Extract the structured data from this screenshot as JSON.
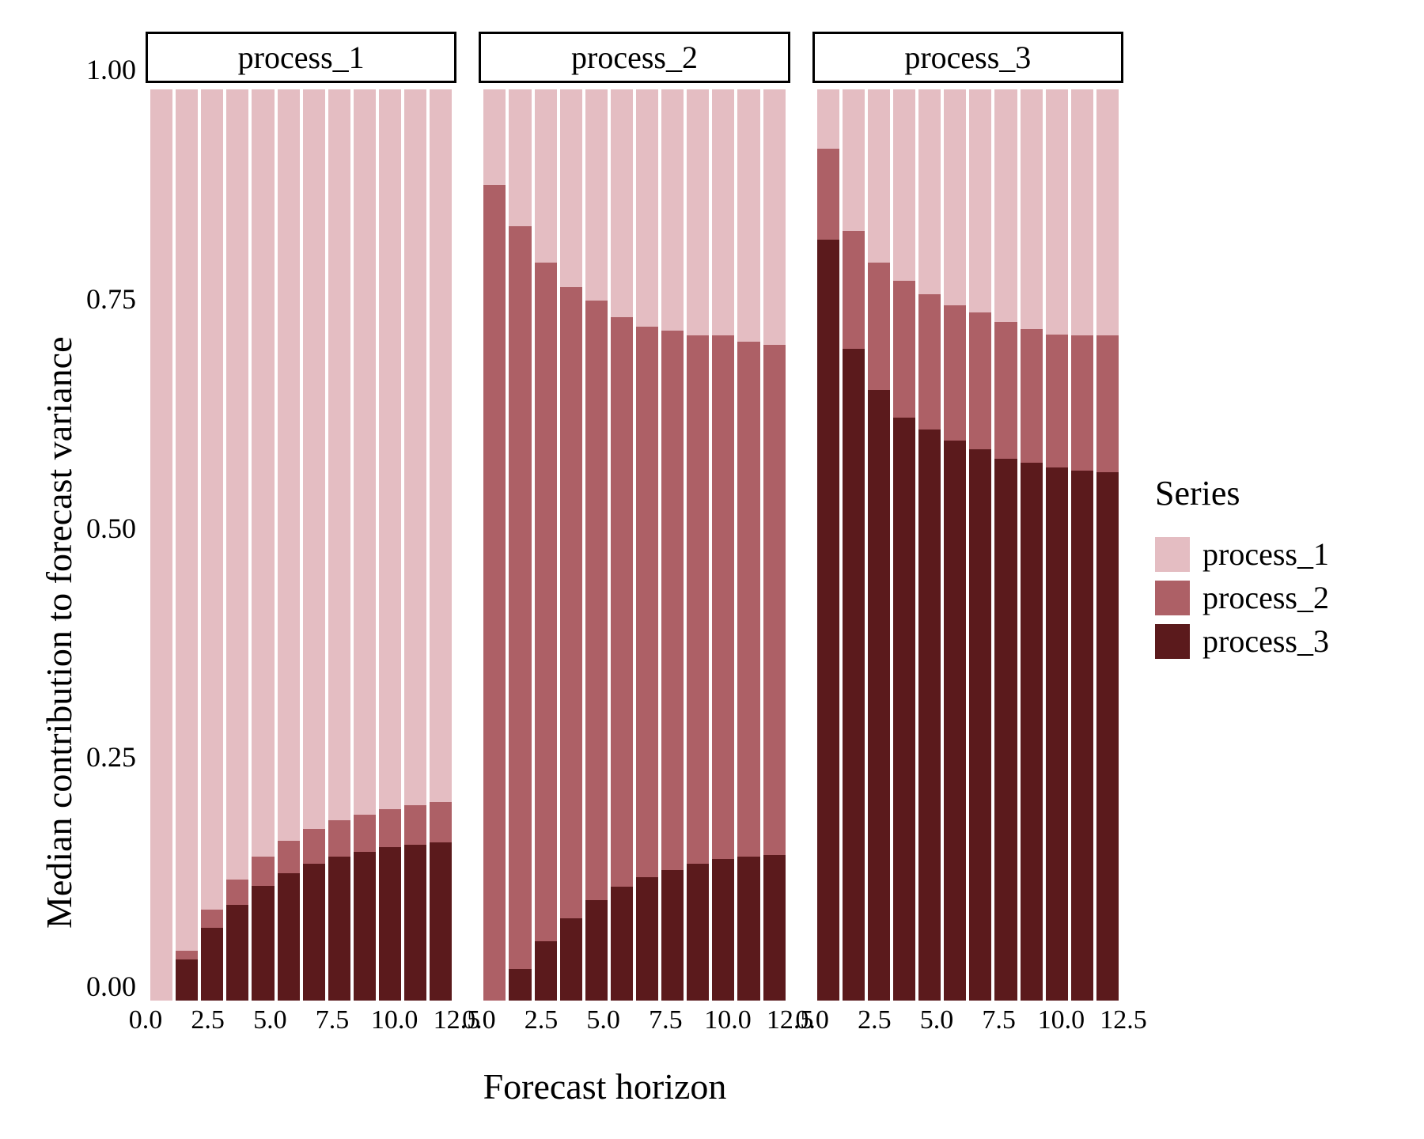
{
  "chart_data": {
    "type": "bar",
    "stacked": true,
    "facet_by": "panel",
    "title": "",
    "xlabel": "Forecast horizon",
    "ylabel": "Median contribution to forecast variance",
    "ylim": [
      0,
      1
    ],
    "y_ticks": [
      0.0,
      0.25,
      0.5,
      0.75,
      1.0
    ],
    "x_ticks": [
      0.0,
      2.5,
      5.0,
      7.5,
      10.0,
      12.5
    ],
    "x_tick_labels": [
      "0.0",
      "2.5",
      "5.0",
      "7.5",
      "10.0",
      "12.5"
    ],
    "x": [
      1,
      2,
      3,
      4,
      5,
      6,
      7,
      8,
      9,
      10,
      11,
      12
    ],
    "legend": {
      "title": "Series",
      "position": "right"
    },
    "series_levels": [
      "process_1",
      "process_2",
      "process_3"
    ],
    "colors": {
      "process_1": "#e4bdc2",
      "process_2": "#ad6066",
      "process_3": "#5b1a1c"
    },
    "panels": [
      {
        "name": "process_1",
        "series": [
          {
            "name": "process_3",
            "values": [
              0.0,
              0.045,
              0.08,
              0.105,
              0.126,
              0.14,
              0.15,
              0.158,
              0.163,
              0.168,
              0.171,
              0.174
            ]
          },
          {
            "name": "process_2",
            "values": [
              0.0,
              0.01,
              0.02,
              0.028,
              0.032,
              0.035,
              0.038,
              0.04,
              0.041,
              0.042,
              0.043,
              0.044
            ]
          },
          {
            "name": "process_1",
            "values": [
              1.0,
              0.945,
              0.9,
              0.867,
              0.842,
              0.825,
              0.812,
              0.802,
              0.796,
              0.79,
              0.786,
              0.782
            ]
          }
        ]
      },
      {
        "name": "process_2",
        "series": [
          {
            "name": "process_3",
            "values": [
              0.0,
              0.035,
              0.065,
              0.09,
              0.11,
              0.125,
              0.135,
              0.143,
              0.15,
              0.155,
              0.158,
              0.16
            ]
          },
          {
            "name": "process_2",
            "values": [
              0.895,
              0.815,
              0.745,
              0.693,
              0.658,
              0.625,
              0.605,
              0.592,
              0.58,
              0.575,
              0.565,
              0.56
            ]
          },
          {
            "name": "process_1",
            "values": [
              0.105,
              0.15,
              0.19,
              0.217,
              0.232,
              0.25,
              0.26,
              0.265,
              0.27,
              0.27,
              0.277,
              0.28
            ]
          }
        ]
      },
      {
        "name": "process_3",
        "series": [
          {
            "name": "process_3",
            "values": [
              0.835,
              0.715,
              0.67,
              0.64,
              0.627,
              0.615,
              0.605,
              0.595,
              0.59,
              0.585,
              0.582,
              0.58
            ]
          },
          {
            "name": "process_2",
            "values": [
              0.1,
              0.13,
              0.14,
              0.15,
              0.148,
              0.148,
              0.15,
              0.15,
              0.147,
              0.146,
              0.148,
              0.15
            ]
          },
          {
            "name": "process_1",
            "values": [
              0.065,
              0.155,
              0.19,
              0.21,
              0.225,
              0.237,
              0.245,
              0.255,
              0.263,
              0.269,
              0.27,
              0.27
            ]
          }
        ]
      }
    ]
  }
}
